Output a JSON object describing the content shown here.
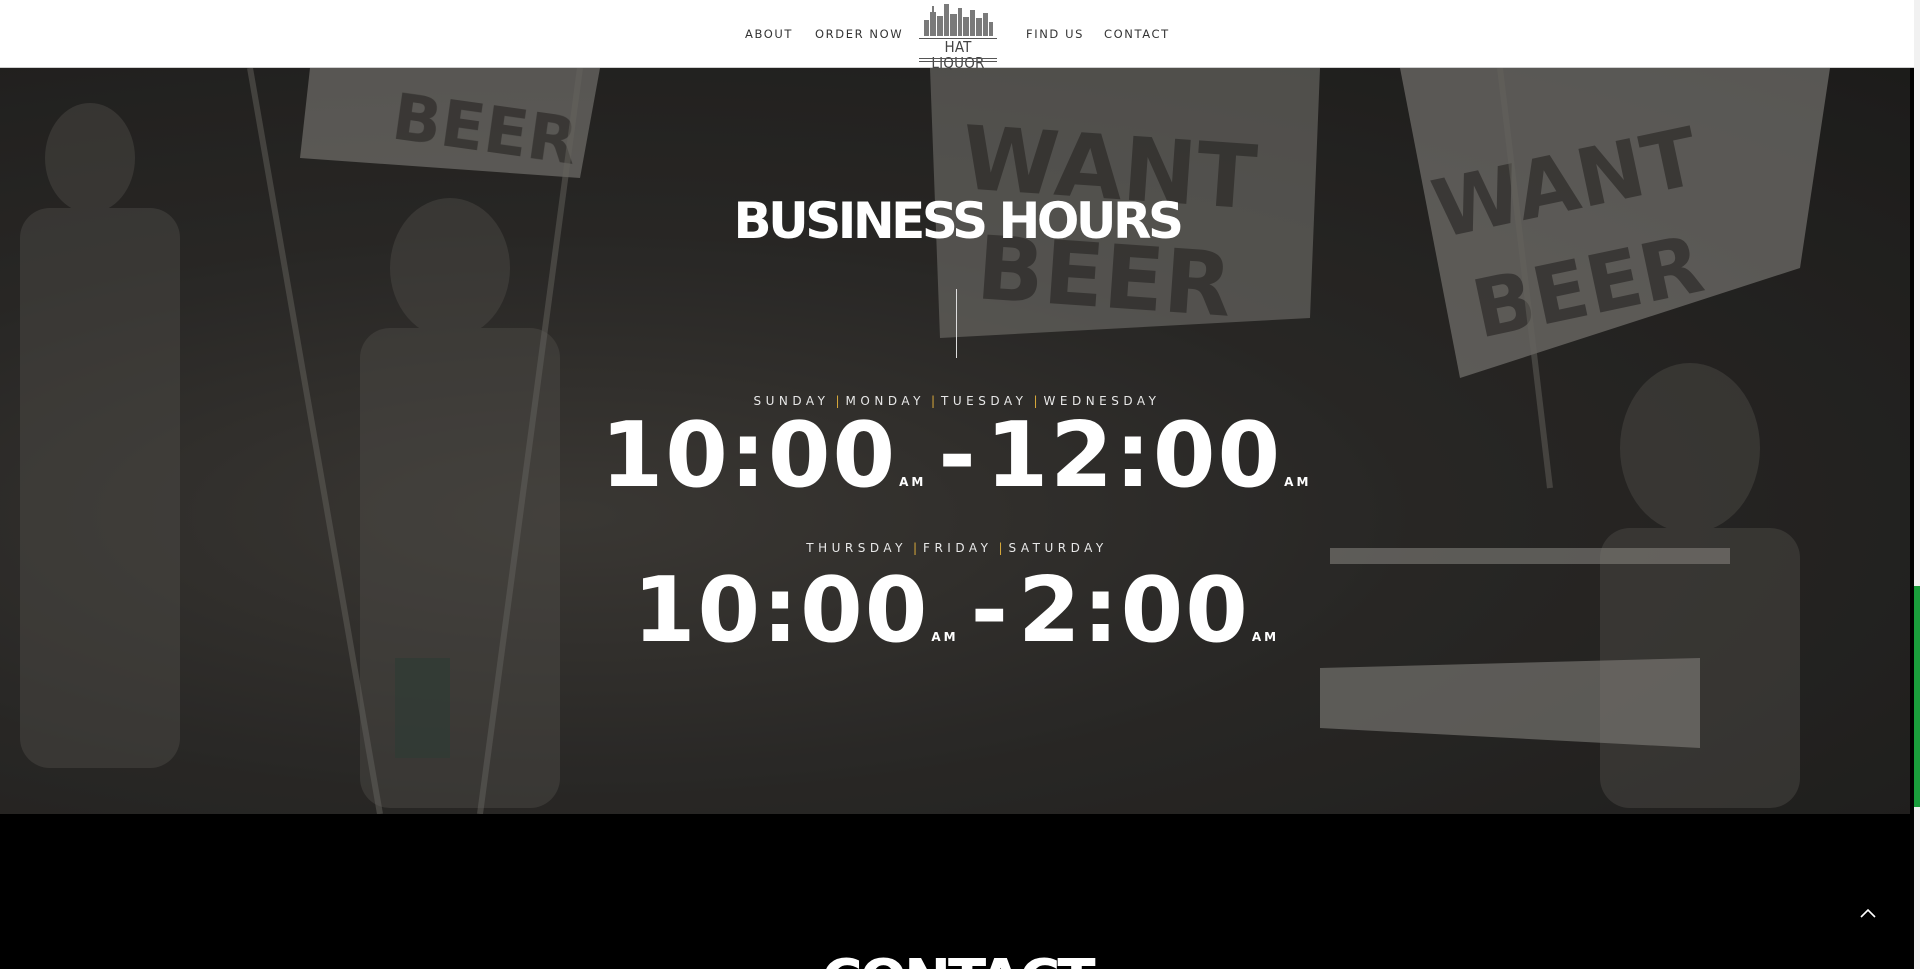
{
  "nav": {
    "about": "ABOUT",
    "order_now": "ORDER NOW",
    "find_us": "FIND US",
    "contact": "CONTACT",
    "logo_text": "HAT LIQUOR"
  },
  "hero": {
    "title": "BUSINESS HOURS",
    "schedule": [
      {
        "days": [
          "SUNDAY",
          "MONDAY",
          "TUESDAY",
          "WEDNESDAY"
        ],
        "separator": "|",
        "open": "10:00",
        "open_period": "AM",
        "dash": "-",
        "close": "12:00",
        "close_period": "AM"
      },
      {
        "days": [
          "THURSDAY",
          "FRIDAY",
          "SATURDAY"
        ],
        "separator": "|",
        "open": "10:00",
        "open_period": "AM",
        "dash": "-",
        "close": "2:00",
        "close_period": "AM"
      }
    ]
  },
  "contact": {
    "title": "CONTACT"
  },
  "icons": {
    "scroll_top": "chevron-up-icon",
    "logo": "city-skyline-icon"
  },
  "colors": {
    "day_separator": "#d9a93b",
    "scrollbar_thumb": "#1a9d3c"
  }
}
